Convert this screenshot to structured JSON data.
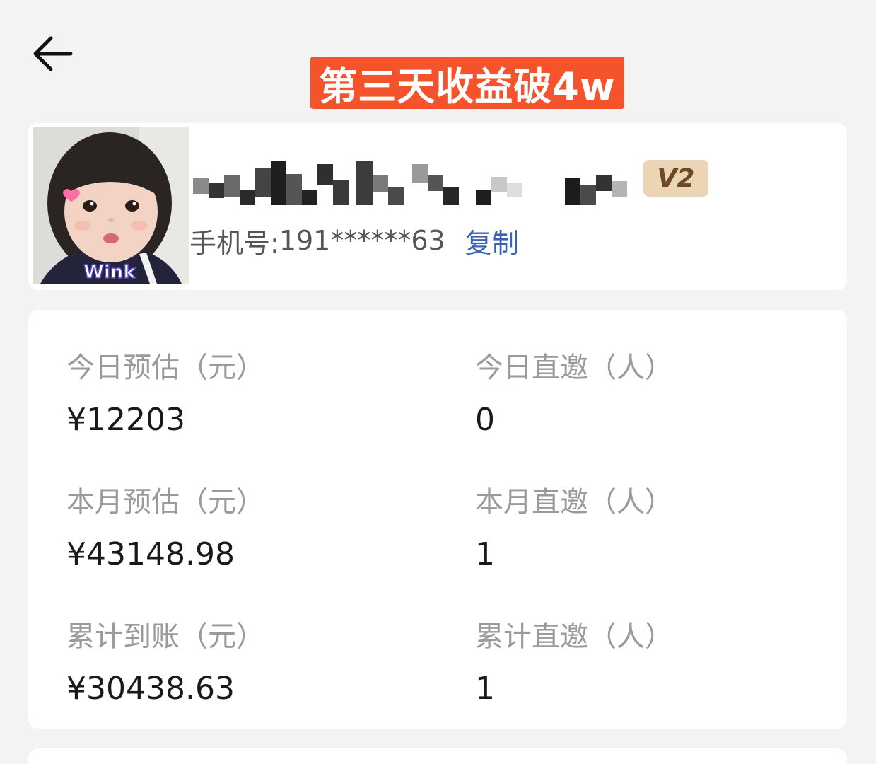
{
  "header": {
    "back_icon": "arrow-left-icon",
    "banner_text": "第三天收益破4w"
  },
  "profile": {
    "avatar_caption": "Wink",
    "username": "",
    "level": "V2",
    "phone_label": "手机号:",
    "phone_number": "191******63",
    "copy_label": "复制"
  },
  "stats": [
    {
      "label": "今日预估（元）",
      "value": "¥12203"
    },
    {
      "label": "今日直邀（人）",
      "value": "0"
    },
    {
      "label": "本月预估（元）",
      "value": "¥43148.98"
    },
    {
      "label": "本月直邀（人）",
      "value": "1"
    },
    {
      "label": "累计到账（元）",
      "value": "¥30438.63"
    },
    {
      "label": "累计直邀（人）",
      "value": "1"
    }
  ],
  "colors": {
    "banner_bg": "#f4532b",
    "link": "#3b62b5",
    "badge_bg": "#ecd5b5",
    "page_bg": "#f3f3f3"
  }
}
